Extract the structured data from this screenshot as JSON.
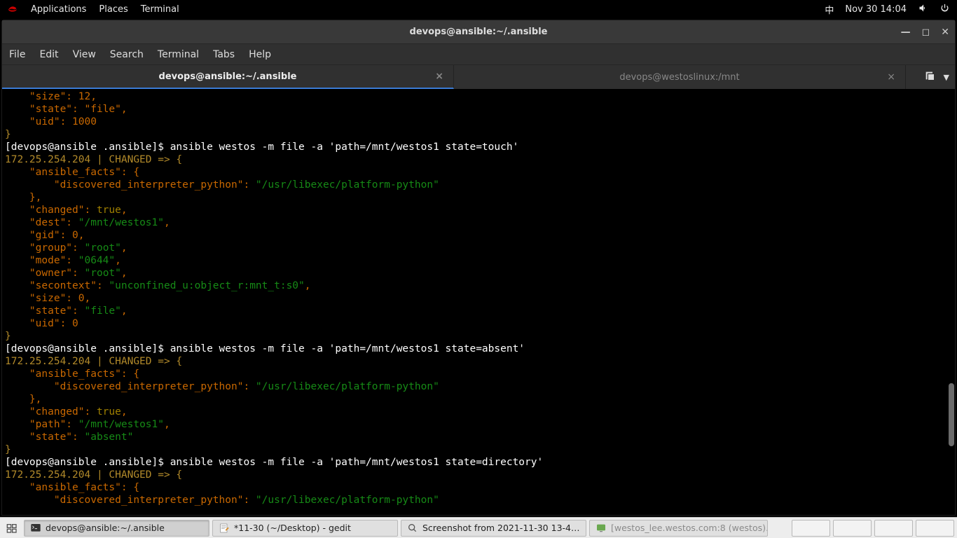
{
  "topbar": {
    "apps": "Applications",
    "places": "Places",
    "term": "Terminal",
    "ime": "中",
    "clock": "Nov 30  14:04"
  },
  "window": {
    "title": "devops@ansible:~/.ansible",
    "menu": {
      "file": "File",
      "edit": "Edit",
      "view": "View",
      "search": "Search",
      "terminal": "Terminal",
      "tabs": "Tabs",
      "help": "Help"
    }
  },
  "tabs": [
    {
      "label": "devops@ansible:~/.ansible",
      "active": true
    },
    {
      "label": "devops@westoslinux:/mnt",
      "active": false
    }
  ],
  "taskbar": {
    "t1": "devops@ansible:~/.ansible",
    "t2": "*11-30 (~/Desktop) - gedit",
    "t3": "Screenshot from 2021-11-30 13-4…",
    "t4": "[westos_lee.westos.com:8 (westos)…"
  },
  "term": {
    "l00": "    \"size\": 12,",
    "l01": "    \"state\": \"file\",",
    "l02": "    \"uid\": 1000",
    "l03": "}",
    "p1a": "[devops@ansible .ansible]$ ",
    "p1b": "ansible westos -m file -a 'path=/mnt/westos1 state=touch'",
    "r1": "172.25.254.204 | CHANGED => {",
    "l05": "    \"ansible_facts\": {",
    "l06a": "        \"discovered_interpreter_python\": ",
    "l06b": "\"/usr/libexec/platform-python\"",
    "l07": "    },",
    "l08a": "    \"changed\": ",
    "l08b": "true",
    "l08c": ",",
    "l09a": "    \"dest\": ",
    "l09b": "\"/mnt/westos1\"",
    "l09c": ",",
    "l10": "    \"gid\": 0,",
    "l11a": "    \"group\": ",
    "l11b": "\"root\"",
    "l11c": ",",
    "l12a": "    \"mode\": ",
    "l12b": "\"0644\"",
    "l12c": ",",
    "l13a": "    \"owner\": ",
    "l13b": "\"root\"",
    "l13c": ",",
    "l14a": "    \"secontext\": ",
    "l14b": "\"unconfined_u:object_r:mnt_t:s0\"",
    "l14c": ",",
    "l15": "    \"size\": 0,",
    "l16a": "    \"state\": ",
    "l16b": "\"file\"",
    "l16c": ",",
    "l17": "    \"uid\": 0",
    "l18": "}",
    "p2a": "[devops@ansible .ansible]$ ",
    "p2b": "ansible westos -m file -a 'path=/mnt/westos1 state=absent'",
    "r2": "172.25.254.204 | CHANGED => {",
    "l20": "    \"ansible_facts\": {",
    "l21a": "        \"discovered_interpreter_python\": ",
    "l21b": "\"/usr/libexec/platform-python\"",
    "l22": "    },",
    "l23a": "    \"changed\": ",
    "l23b": "true",
    "l23c": ",",
    "l24a": "    \"path\": ",
    "l24b": "\"/mnt/westos1\"",
    "l24c": ",",
    "l25a": "    \"state\": ",
    "l25b": "\"absent\"",
    "l26": "}",
    "p3a": "[devops@ansible .ansible]$ ",
    "p3b": "ansible westos -m file -a 'path=/mnt/westos1 state=directory'",
    "r3": "172.25.254.204 | CHANGED => {",
    "l28": "    \"ansible_facts\": {",
    "l29a": "        \"discovered_interpreter_python\": ",
    "l29b": "\"/usr/libexec/platform-python\""
  }
}
